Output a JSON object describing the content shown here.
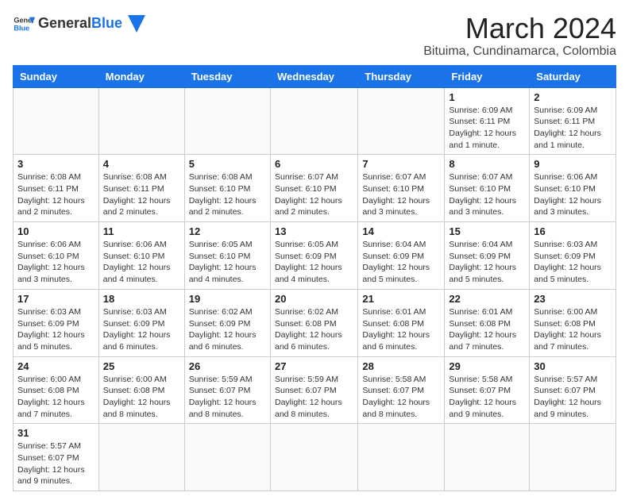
{
  "logo": {
    "text_general": "General",
    "text_blue": "Blue"
  },
  "header": {
    "title": "March 2024",
    "subtitle": "Bituima, Cundinamarca, Colombia"
  },
  "days_of_week": [
    "Sunday",
    "Monday",
    "Tuesday",
    "Wednesday",
    "Thursday",
    "Friday",
    "Saturday"
  ],
  "weeks": [
    [
      {
        "day": "",
        "info": ""
      },
      {
        "day": "",
        "info": ""
      },
      {
        "day": "",
        "info": ""
      },
      {
        "day": "",
        "info": ""
      },
      {
        "day": "",
        "info": ""
      },
      {
        "day": "1",
        "info": "Sunrise: 6:09 AM\nSunset: 6:11 PM\nDaylight: 12 hours and 1 minute."
      },
      {
        "day": "2",
        "info": "Sunrise: 6:09 AM\nSunset: 6:11 PM\nDaylight: 12 hours and 1 minute."
      }
    ],
    [
      {
        "day": "3",
        "info": "Sunrise: 6:08 AM\nSunset: 6:11 PM\nDaylight: 12 hours and 2 minutes."
      },
      {
        "day": "4",
        "info": "Sunrise: 6:08 AM\nSunset: 6:11 PM\nDaylight: 12 hours and 2 minutes."
      },
      {
        "day": "5",
        "info": "Sunrise: 6:08 AM\nSunset: 6:10 PM\nDaylight: 12 hours and 2 minutes."
      },
      {
        "day": "6",
        "info": "Sunrise: 6:07 AM\nSunset: 6:10 PM\nDaylight: 12 hours and 2 minutes."
      },
      {
        "day": "7",
        "info": "Sunrise: 6:07 AM\nSunset: 6:10 PM\nDaylight: 12 hours and 3 minutes."
      },
      {
        "day": "8",
        "info": "Sunrise: 6:07 AM\nSunset: 6:10 PM\nDaylight: 12 hours and 3 minutes."
      },
      {
        "day": "9",
        "info": "Sunrise: 6:06 AM\nSunset: 6:10 PM\nDaylight: 12 hours and 3 minutes."
      }
    ],
    [
      {
        "day": "10",
        "info": "Sunrise: 6:06 AM\nSunset: 6:10 PM\nDaylight: 12 hours and 3 minutes."
      },
      {
        "day": "11",
        "info": "Sunrise: 6:06 AM\nSunset: 6:10 PM\nDaylight: 12 hours and 4 minutes."
      },
      {
        "day": "12",
        "info": "Sunrise: 6:05 AM\nSunset: 6:10 PM\nDaylight: 12 hours and 4 minutes."
      },
      {
        "day": "13",
        "info": "Sunrise: 6:05 AM\nSunset: 6:09 PM\nDaylight: 12 hours and 4 minutes."
      },
      {
        "day": "14",
        "info": "Sunrise: 6:04 AM\nSunset: 6:09 PM\nDaylight: 12 hours and 5 minutes."
      },
      {
        "day": "15",
        "info": "Sunrise: 6:04 AM\nSunset: 6:09 PM\nDaylight: 12 hours and 5 minutes."
      },
      {
        "day": "16",
        "info": "Sunrise: 6:03 AM\nSunset: 6:09 PM\nDaylight: 12 hours and 5 minutes."
      }
    ],
    [
      {
        "day": "17",
        "info": "Sunrise: 6:03 AM\nSunset: 6:09 PM\nDaylight: 12 hours and 5 minutes."
      },
      {
        "day": "18",
        "info": "Sunrise: 6:03 AM\nSunset: 6:09 PM\nDaylight: 12 hours and 6 minutes."
      },
      {
        "day": "19",
        "info": "Sunrise: 6:02 AM\nSunset: 6:09 PM\nDaylight: 12 hours and 6 minutes."
      },
      {
        "day": "20",
        "info": "Sunrise: 6:02 AM\nSunset: 6:08 PM\nDaylight: 12 hours and 6 minutes."
      },
      {
        "day": "21",
        "info": "Sunrise: 6:01 AM\nSunset: 6:08 PM\nDaylight: 12 hours and 6 minutes."
      },
      {
        "day": "22",
        "info": "Sunrise: 6:01 AM\nSunset: 6:08 PM\nDaylight: 12 hours and 7 minutes."
      },
      {
        "day": "23",
        "info": "Sunrise: 6:00 AM\nSunset: 6:08 PM\nDaylight: 12 hours and 7 minutes."
      }
    ],
    [
      {
        "day": "24",
        "info": "Sunrise: 6:00 AM\nSunset: 6:08 PM\nDaylight: 12 hours and 7 minutes."
      },
      {
        "day": "25",
        "info": "Sunrise: 6:00 AM\nSunset: 6:08 PM\nDaylight: 12 hours and 8 minutes."
      },
      {
        "day": "26",
        "info": "Sunrise: 5:59 AM\nSunset: 6:07 PM\nDaylight: 12 hours and 8 minutes."
      },
      {
        "day": "27",
        "info": "Sunrise: 5:59 AM\nSunset: 6:07 PM\nDaylight: 12 hours and 8 minutes."
      },
      {
        "day": "28",
        "info": "Sunrise: 5:58 AM\nSunset: 6:07 PM\nDaylight: 12 hours and 8 minutes."
      },
      {
        "day": "29",
        "info": "Sunrise: 5:58 AM\nSunset: 6:07 PM\nDaylight: 12 hours and 9 minutes."
      },
      {
        "day": "30",
        "info": "Sunrise: 5:57 AM\nSunset: 6:07 PM\nDaylight: 12 hours and 9 minutes."
      }
    ],
    [
      {
        "day": "31",
        "info": "Sunrise: 5:57 AM\nSunset: 6:07 PM\nDaylight: 12 hours and 9 minutes."
      },
      {
        "day": "",
        "info": ""
      },
      {
        "day": "",
        "info": ""
      },
      {
        "day": "",
        "info": ""
      },
      {
        "day": "",
        "info": ""
      },
      {
        "day": "",
        "info": ""
      },
      {
        "day": "",
        "info": ""
      }
    ]
  ]
}
